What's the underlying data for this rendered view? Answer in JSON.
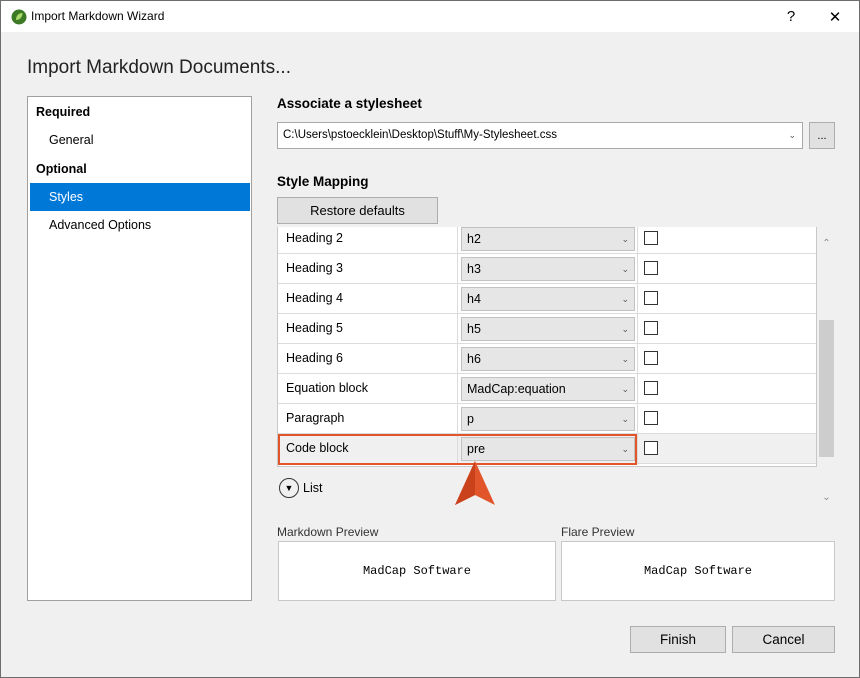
{
  "window": {
    "title": "Import Markdown Wizard",
    "help_label": "?",
    "close_label": "✕"
  },
  "page_heading": "Import Markdown Documents...",
  "nav": {
    "groups": [
      {
        "label": "Required",
        "items": [
          {
            "label": "General",
            "selected": false
          }
        ]
      },
      {
        "label": "Optional",
        "items": [
          {
            "label": "Styles",
            "selected": true
          },
          {
            "label": "Advanced Options",
            "selected": false
          }
        ]
      }
    ]
  },
  "stylesheet": {
    "section_label": "Associate a stylesheet",
    "path_value": "C:\\Users\\pstoecklein\\Desktop\\Stuff\\My-Stylesheet.css",
    "browse_label": "..."
  },
  "style_mapping": {
    "section_label": "Style Mapping",
    "restore_label": "Restore defaults",
    "rows": [
      {
        "element": "Heading 2",
        "style": "h2",
        "checked": false
      },
      {
        "element": "Heading 3",
        "style": "h3",
        "checked": false
      },
      {
        "element": "Heading 4",
        "style": "h4",
        "checked": false
      },
      {
        "element": "Heading 5",
        "style": "h5",
        "checked": false
      },
      {
        "element": "Heading 6",
        "style": "h6",
        "checked": false
      },
      {
        "element": "Equation block",
        "style": "MadCap:equation",
        "checked": false
      },
      {
        "element": "Paragraph",
        "style": "p",
        "checked": false
      },
      {
        "element": "Code block",
        "style": "pre",
        "checked": false,
        "highlighted": true
      }
    ],
    "list_expander_label": "List"
  },
  "preview": {
    "markdown_label": "Markdown Preview",
    "markdown_text": "MadCap Software",
    "flare_label": "Flare Preview",
    "flare_text": "MadCap Software"
  },
  "footer": {
    "finish_label": "Finish",
    "cancel_label": "Cancel"
  },
  "colors": {
    "selection": "#0078d7",
    "highlight_border": "#e2552a",
    "pointer": "#e2552a"
  },
  "icons": {
    "app": "flare-leaf-icon",
    "dropdown": "chevron-down-icon",
    "expander": "circle-chevron-down-icon",
    "annotation": "arrow-pointer-icon"
  }
}
